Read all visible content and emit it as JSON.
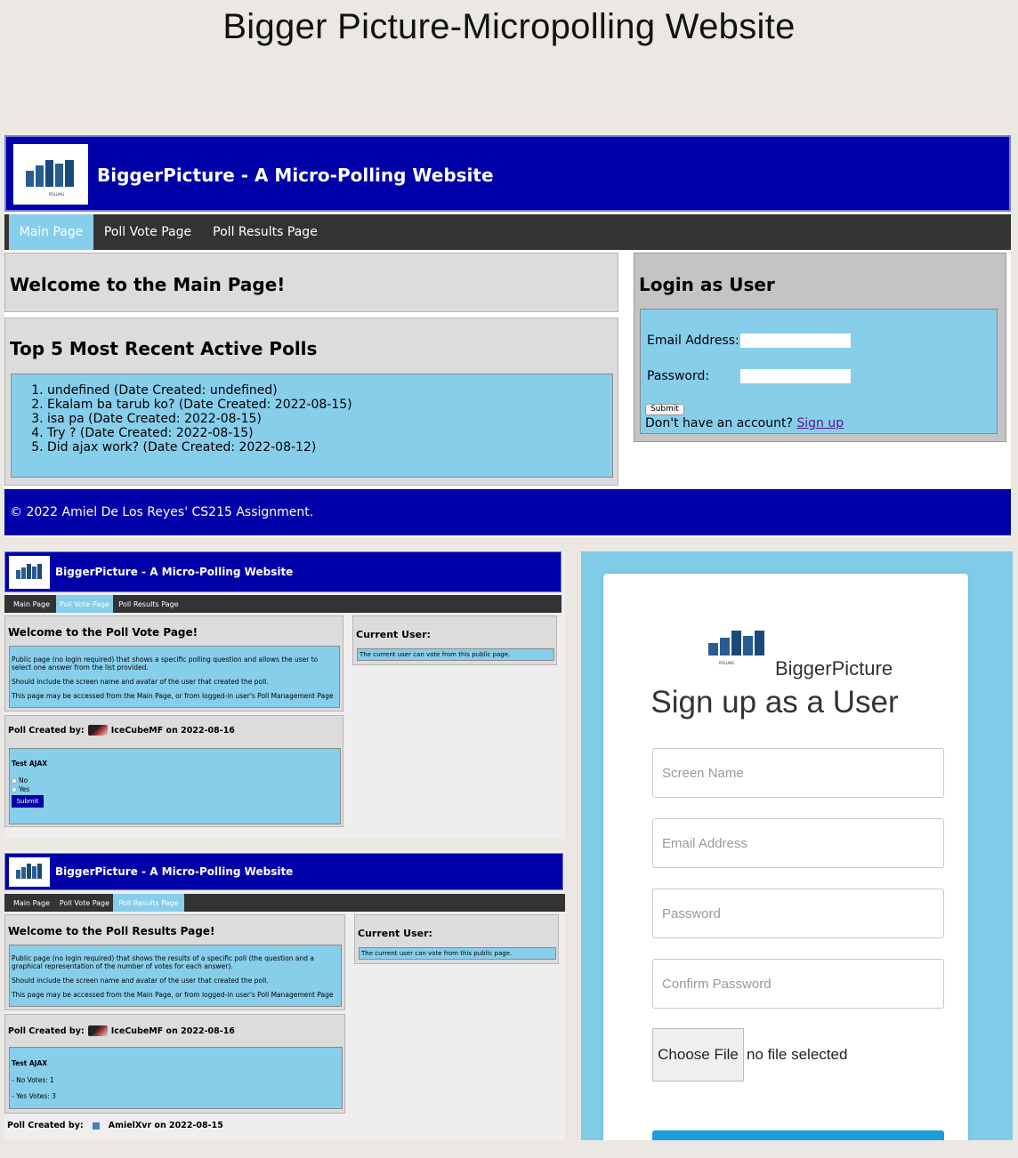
{
  "page_title": "Bigger Picture-Micropolling Website",
  "logo_text": "POLLING",
  "colors": {
    "header_blue": "#0000a8",
    "nav_dark": "#333333",
    "nav_active": "#87ceeb",
    "panel_gray": "#dcdcdc",
    "panel_blue": "#87ceeb",
    "signup_bg": "#7fcbe8",
    "signup_button": "#1d9ed8"
  },
  "main": {
    "site_title": "BiggerPicture - A Micro-Polling Website",
    "nav": [
      "Main Page",
      "Poll Vote Page",
      "Poll Results Page"
    ],
    "active_nav": "Main Page",
    "welcome": "Welcome to the Main Page!",
    "top_polls_heading": "Top 5 Most Recent Active Polls",
    "polls": [
      "undefined (Date Created: undefined)",
      "Ekalam ba tarub ko? (Date Created: 2022-08-15)",
      "isa pa (Date Created: 2022-08-15)",
      "Try ? (Date Created: 2022-08-15)",
      "Did ajax work? (Date Created: 2022-08-12)"
    ],
    "login_heading": "Login as User",
    "email_label": "Email Address:",
    "password_label": "Password:",
    "submit_label": "Submit",
    "no_account_text": "Don't have an account?",
    "signup_link": "Sign up",
    "footer": "© 2022 Amiel De Los Reyes' CS215 Assignment."
  },
  "vote_page": {
    "site_title": "BiggerPicture - A Micro-Polling Website",
    "nav": [
      "Main Page",
      "Poll Vote Page",
      "Poll Results Page"
    ],
    "active_nav": "Poll Vote Page",
    "welcome": "Welcome to the Poll Vote Page!",
    "desc": [
      "Public page (no login required) that shows a specific polling question and allows the user to select one answer from the list provided.",
      "Should include the screen name and avatar of the user that created the poll.",
      "This page may be accessed from the Main Page, or from logged-in user's Poll Management Page"
    ],
    "current_user_heading": "Current User:",
    "current_user_text": "The current user can vote from this public page.",
    "created_by_label": "Poll Created by:",
    "creator": "IceCubeMF on 2022-08-16",
    "question": "Test AJAX",
    "options": [
      "No",
      "Yes"
    ],
    "submit_label": "Submit"
  },
  "results_page": {
    "site_title": "BiggerPicture - A Micro-Polling Website",
    "nav": [
      "Main Page",
      "Poll Vote Page",
      "Poll Results Page"
    ],
    "active_nav": "Poll Results Page",
    "welcome": "Welcome to the Poll Results Page!",
    "desc": [
      "Public page (no login required) that shows the results of a specific poll (the question and a graphical representation of the number of votes for each answer).",
      "Should include the screen name and avatar of the user that created the poll.",
      "This page may be accessed from the Main Page, or from logged-in user's Poll Management Page"
    ],
    "current_user_heading": "Current User:",
    "current_user_text": "The current user can vote from this public page.",
    "created_by_label": "Poll Created by:",
    "creator": "IceCubeMF on 2022-08-16",
    "question": "Test AJAX",
    "results": [
      "- No Votes: 1",
      "- Yes Votes: 3"
    ],
    "creator2": "AmielXvr on 2022-08-15"
  },
  "signup": {
    "brand": "BiggerPicture",
    "heading": "Sign up as a User",
    "fields": [
      "Screen Name",
      "Email Address",
      "Password",
      "Confirm Password"
    ],
    "choose_file": "Choose File",
    "no_file": "no file selected"
  }
}
